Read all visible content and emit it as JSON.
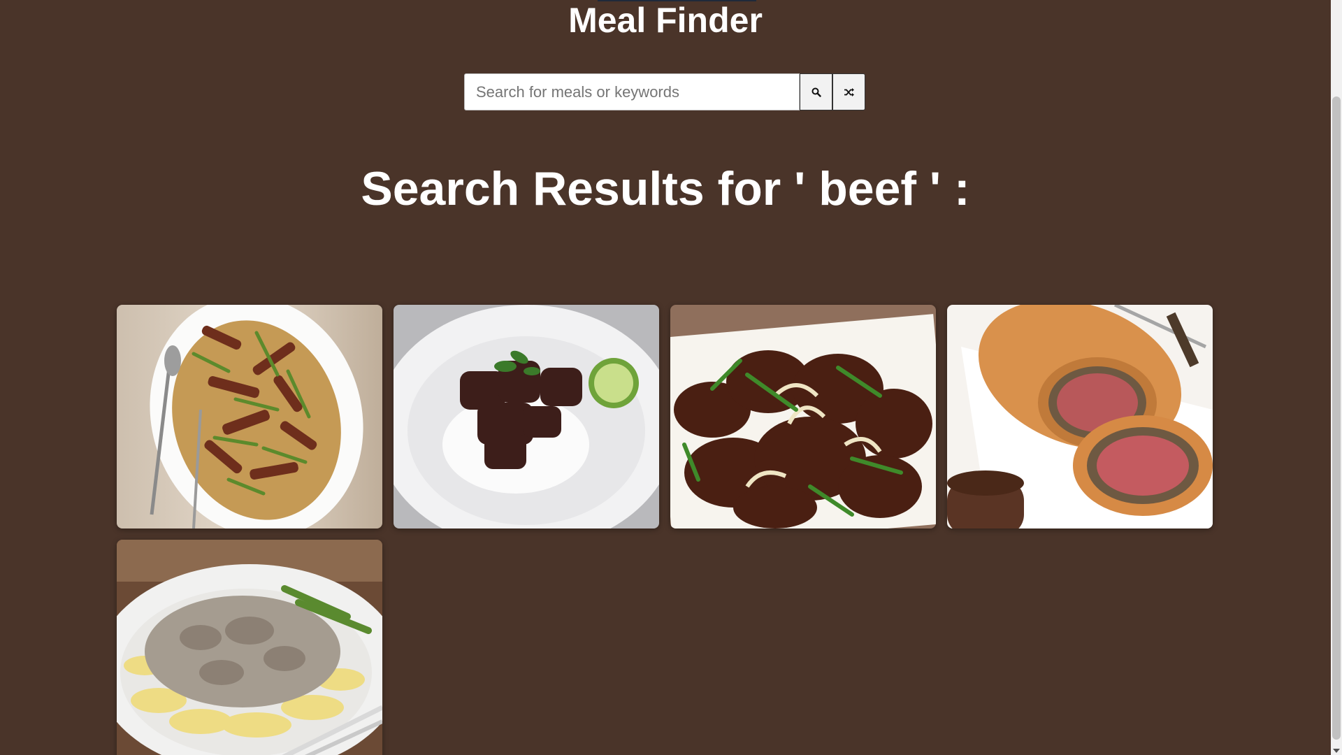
{
  "header": {
    "title": "Meal Finder"
  },
  "search": {
    "placeholder": "Search for meals or keywords",
    "value": "",
    "search_button_icon": "search-icon",
    "random_button_icon": "shuffle-icon"
  },
  "results": {
    "heading": "Search Results for ' beef ' :",
    "meals": [
      {
        "image": "beef and asparagus stir fry on noodles"
      },
      {
        "image": "braised beef with rice and lime"
      },
      {
        "image": "beef with onions and scallions"
      },
      {
        "image": "beef wellington"
      },
      {
        "image": "beef stroganoff with egg noodles"
      }
    ]
  },
  "colors": {
    "background": "#4a3429",
    "text": "#ffffff",
    "button_bg": "#f2f2f2"
  }
}
